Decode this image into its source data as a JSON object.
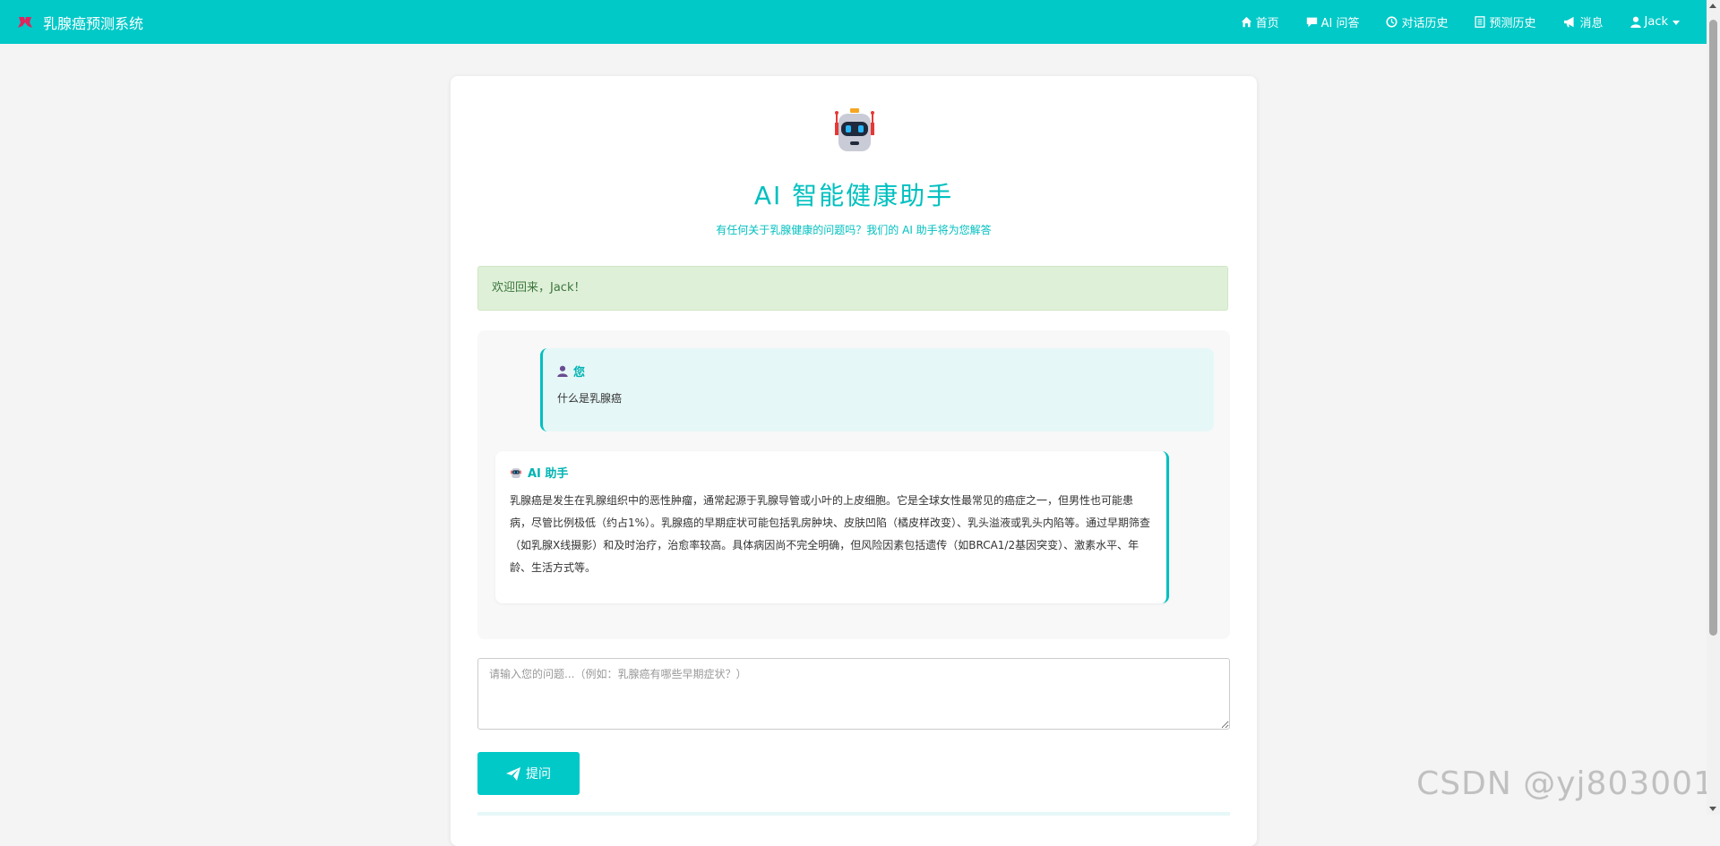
{
  "navbar": {
    "brand": "乳腺癌预测系统",
    "items": [
      {
        "label": "首页",
        "icon": "home-icon"
      },
      {
        "label": "AI 问答",
        "icon": "comment-icon"
      },
      {
        "label": "对话历史",
        "icon": "clock-icon"
      },
      {
        "label": "预测历史",
        "icon": "list-icon"
      },
      {
        "label": "消息",
        "icon": "bullhorn-icon"
      },
      {
        "label": "Jack",
        "icon": "user-icon"
      }
    ]
  },
  "header": {
    "title": "AI 智能健康助手",
    "subtitle": "有任何关于乳腺健康的问题吗？我们的 AI 助手将为您解答"
  },
  "welcome": "欢迎回来，Jack！",
  "chat": {
    "user_message": {
      "sender": "您",
      "text": "什么是乳腺癌"
    },
    "ai_message": {
      "sender": "AI 助手",
      "text": "乳腺癌是发生在乳腺组织中的恶性肿瘤，通常起源于乳腺导管或小叶的上皮细胞。它是全球女性最常见的癌症之一，但男性也可能患病，尽管比例极低（约占1%）。乳腺癌的早期症状可能包括乳房肿块、皮肤凹陷（橘皮样改变）、乳头溢液或乳头内陷等。通过早期筛查（如乳腺X线摄影）和及时治疗，治愈率较高。具体病因尚不完全明确，但风险因素包括遗传（如BRCA1/2基因突变）、激素水平、年龄、生活方式等。"
    }
  },
  "input": {
    "placeholder": "请输入您的问题...（例如：乳腺癌有哪些早期症状？）",
    "value": ""
  },
  "ask_button": "提问",
  "watermark": "CSDN @yj803001",
  "colors": {
    "primary": "#00c9c8",
    "success_bg": "#dff0d8",
    "success_text": "#3c763d"
  }
}
